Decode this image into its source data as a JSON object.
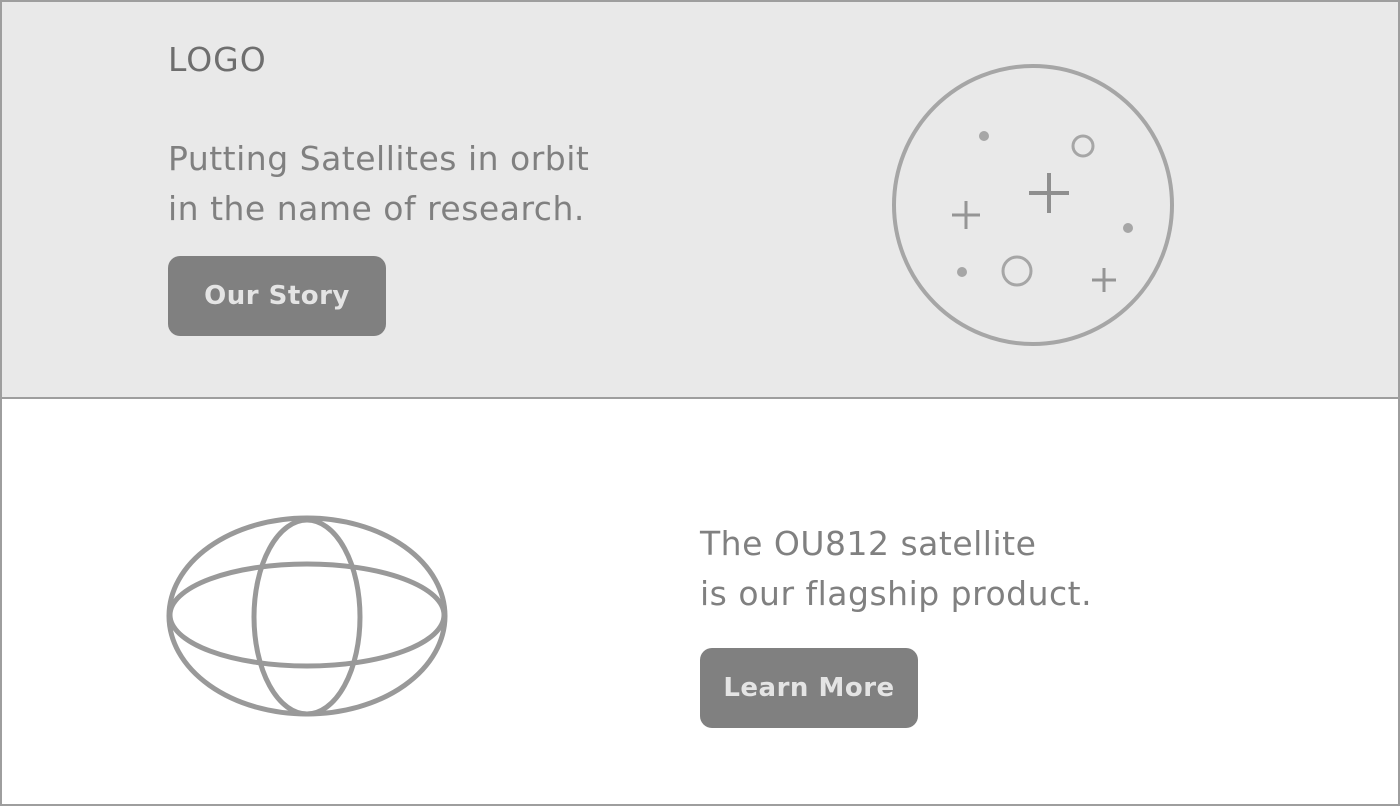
{
  "header": {
    "logo_text": "LOGO"
  },
  "hero": {
    "tagline_line1": "Putting Satellites in orbit",
    "tagline_line2": "in the name of research.",
    "cta_label": "Our Story",
    "icon": "planet-stars-icon"
  },
  "feature": {
    "text_line1": "The OU812 satellite",
    "text_line2": "is our flagship product.",
    "cta_label": "Learn More",
    "icon": "globe-satellite-icon"
  },
  "colors": {
    "hero_background": "#e9e9e9",
    "button_background": "#808080",
    "button_text": "#e4e4e4",
    "text": "#808080",
    "border": "#9e9e9e"
  }
}
